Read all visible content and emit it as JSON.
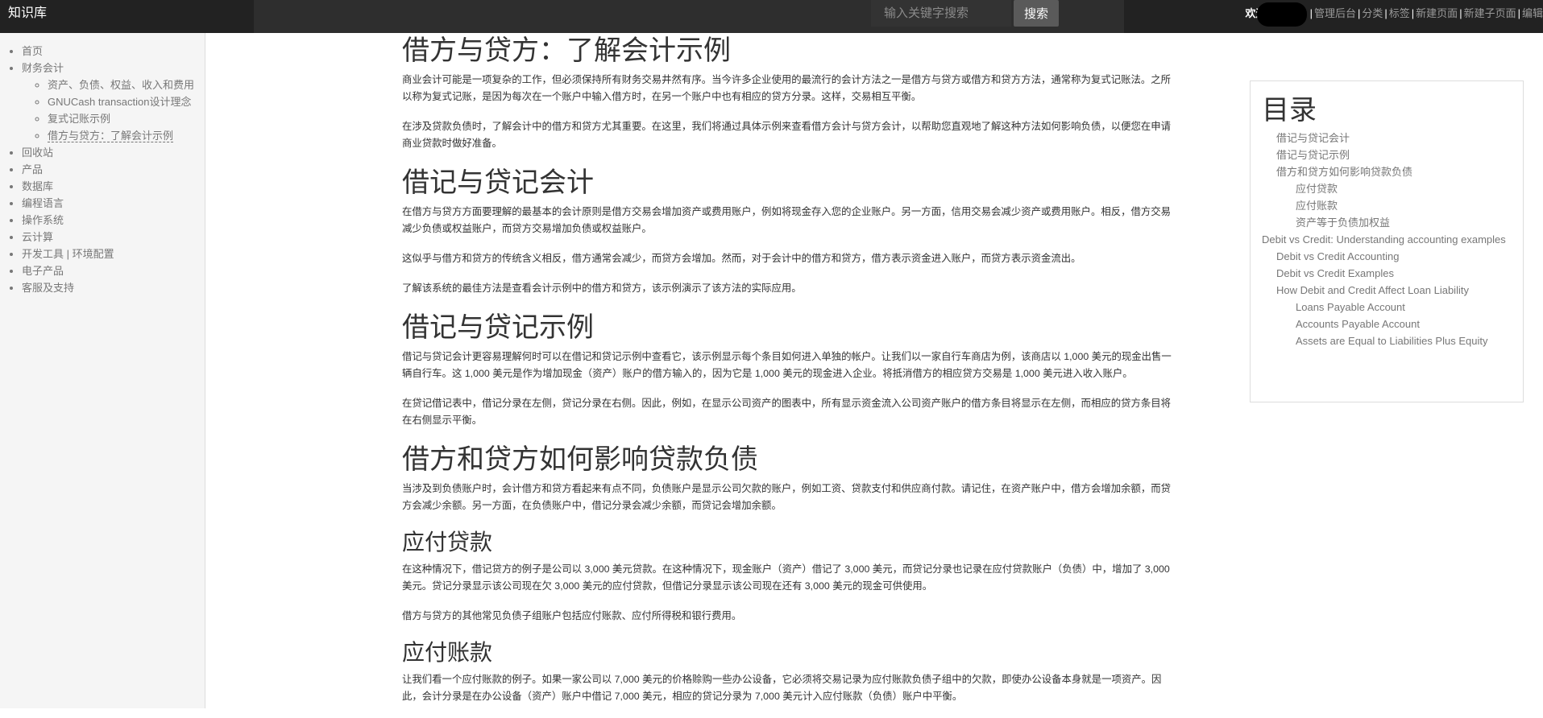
{
  "header": {
    "brand": "知识库",
    "search_placeholder": "输入关键字搜索",
    "search_button": "搜索",
    "welcome": "欢迎",
    "sep": "|",
    "nav_links": [
      "管理后台",
      "分类",
      "标签",
      "新建页面",
      "新建子页面",
      "编辑"
    ]
  },
  "sidebar": {
    "items": [
      "首页",
      "财务会计",
      "回收站",
      "产品",
      "数据库",
      "编程语言",
      "操作系统",
      "云计算",
      "开发工具 | 环境配置",
      "电子产品",
      "客服及支持"
    ],
    "sub_items": [
      "资产、负债、权益、收入和费用",
      "GNUCash transaction设计理念",
      "复式记账示例",
      "借方与贷方：了解会计示例"
    ]
  },
  "article": {
    "title": "借方与贷方：了解会计示例",
    "intro_p1": "商业会计可能是一项复杂的工作，但必须保持所有财务交易井然有序。当今许多企业使用的最流行的会计方法之一是借方与贷方或借方和贷方方法，通常称为复式记账法。之所以称为复式记账，是因为每次在一个账户中输入借方时，在另一个账户中也有相应的贷方分录。这样，交易相互平衡。",
    "intro_p2": "在涉及贷款负债时，了解会计中的借方和贷方尤其重要。在这里，我们将通过具体示例来查看借方会计与贷方会计，以帮助您直观地了解这种方法如何影响负债，以便您在申请商业贷款时做好准备。",
    "s1_title": "借记与贷记会计",
    "s1_p1": "在借方与贷方方面要理解的最基本的会计原则是借方交易会增加资产或费用账户，例如将现金存入您的企业账户。另一方面，信用交易会减少资产或费用账户。相反，借方交易减少负债或权益账户，而贷方交易增加负债或权益账户。",
    "s1_p2": "这似乎与借方和贷方的传统含义相反，借方通常会减少，而贷方会增加。然而，对于会计中的借方和贷方，借方表示资金进入账户，而贷方表示资金流出。",
    "s1_p3": "了解该系统的最佳方法是查看会计示例中的借方和贷方，该示例演示了该方法的实际应用。",
    "s2_title": "借记与贷记示例",
    "s2_p1": "借记与贷记会计更容易理解何时可以在借记和贷记示例中查看它，该示例显示每个条目如何进入单独的帐户。让我们以一家自行车商店为例，该商店以 1,000 美元的现金出售一辆自行车。这 1,000 美元是作为增加现金（资产）账户的借方输入的，因为它是 1,000 美元的现金进入企业。将抵消借方的相应贷方交易是 1,000 美元进入收入账户。",
    "s2_p2": "在贷记借记表中，借记分录在左侧，贷记分录在右侧。因此，例如，在显示公司资产的图表中，所有显示资金流入公司资产账户的借方条目将显示在左侧，而相应的贷方条目将在右侧显示平衡。",
    "s3_title": "借方和贷方如何影响贷款负债",
    "s3_p1": "当涉及到负债账户时，会计借方和贷方看起来有点不同，负债账户是显示公司欠款的账户，例如工资、贷款支付和供应商付款。请记住，在资产账户中，借方会增加余额，而贷方会减少余额。另一方面，在负债账户中，借记分录会减少余额，而贷记会增加余额。",
    "s4_title": "应付贷款",
    "s4_p1": "在这种情况下，借记贷方的例子是公司以 3,000 美元贷款。在这种情况下，现金账户（资产）借记了 3,000 美元，而贷记分录也记录在应付贷款账户（负债）中，增加了 3,000 美元。贷记分录显示该公司现在欠 3,000 美元的应付贷款，但借记分录显示该公司现在还有 3,000 美元的现金可供使用。",
    "s4_p2": "借方与贷方的其他常见负债子组账户包括应付账款、应付所得税和银行费用。",
    "s5_title": "应付账款",
    "s5_p1": "让我们看一个应付账款的例子。如果一家公司以 7,000 美元的价格赊购一些办公设备，它必须将交易记录为应付账款负债子组中的欠款，即使办公设备本身就是一项资产。因此，会计分录是在办公设备（资产）账户中借记 7,000 美元，相应的贷记分录为 7,000 美元计入应付账款（负债）账户中平衡。"
  },
  "toc": {
    "title": "目录",
    "items": [
      {
        "label": "借记与贷记会计",
        "level": 1
      },
      {
        "label": "借记与贷记示例",
        "level": 1
      },
      {
        "label": "借方和贷方如何影响贷款负债",
        "level": 1
      },
      {
        "label": "应付贷款",
        "level": 2
      },
      {
        "label": "应付账款",
        "level": 2
      },
      {
        "label": "资产等于负债加权益",
        "level": 2
      },
      {
        "label": "Debit vs Credit: Understanding accounting examples",
        "level": 0
      },
      {
        "label": "Debit vs Credit Accounting",
        "level": 1
      },
      {
        "label": "Debit vs Credit Examples",
        "level": 1
      },
      {
        "label": "How Debit and Credit Affect Loan Liability",
        "level": 1
      },
      {
        "label": "Loans Payable Account",
        "level": 2
      },
      {
        "label": "Accounts Payable Account",
        "level": 2
      },
      {
        "label": "Assets are Equal to Liabilities Plus Equity",
        "level": 2
      }
    ]
  }
}
